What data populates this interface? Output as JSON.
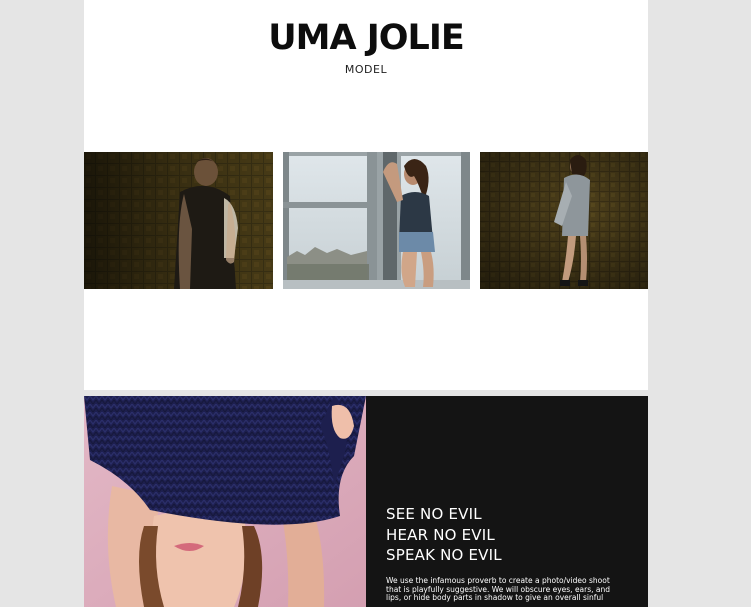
{
  "brand": {
    "title": "UMA JOLIE",
    "subtitle": "MODEL"
  },
  "gallery": {
    "photos": [
      {
        "icon": "photo-woman-sweater-dark-wall"
      },
      {
        "icon": "photo-woman-by-window"
      },
      {
        "icon": "photo-woman-leaning-on-wall"
      }
    ]
  },
  "feature": {
    "image_icon": "photo-woman-sweater-over-head",
    "headline_lines": [
      "SEE NO EVIL",
      "HEAR NO EVIL",
      "SPEAK NO EVIL"
    ],
    "body": "We use the infamous proverb to create a photo/video shoot that is playfully suggestive. We will obscure eyes, ears, and lips, or hide body parts in shadow to give an overall sinful"
  },
  "colors": {
    "background": "#e5e5e5",
    "panel": "#ffffff",
    "dark_panel": "#141414",
    "text_dark": "#0d0d0d",
    "text_light": "#ffffff"
  }
}
